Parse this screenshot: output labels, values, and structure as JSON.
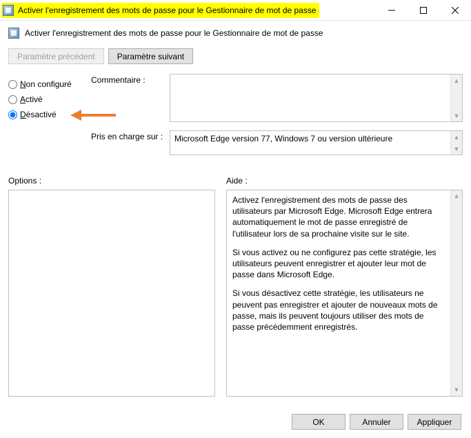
{
  "titlebar": {
    "text": "Activer l'enregistrement des mots de passe pour le Gestionnaire de mot de passe"
  },
  "header": {
    "policy_title": "Activer l'enregistrement des mots de passe pour le Gestionnaire de mot de passe"
  },
  "nav": {
    "prev": "Paramètre précédent",
    "next": "Paramètre suivant"
  },
  "state": {
    "not_configured": "Non configuré",
    "enabled": "Activé",
    "disabled": "Désactivé",
    "selected": "disabled"
  },
  "fields": {
    "comment_label": "Commentaire :",
    "comment_value": "",
    "supported_label": "Pris en charge sur :",
    "supported_value": "Microsoft Edge version 77, Windows 7 ou version ultérieure"
  },
  "panes": {
    "options_label": "Options :",
    "help_label": "Aide :",
    "help_paragraphs": [
      "Activez l'enregistrement des mots de passe des utilisateurs par Microsoft Edge. Microsoft Edge entrera automatiquement le mot de passe enregistré de l'utilisateur lors de sa prochaine visite sur le site.",
      "Si vous activez ou ne configurez pas cette stratégie, les utilisateurs peuvent enregistrer et ajouter leur mot de passe dans Microsoft Edge.",
      "Si vous désactivez cette stratégie, les utilisateurs ne peuvent pas enregistrer et ajouter de nouveaux mots de passe, mais ils peuvent toujours utiliser des mots de passe précédemment enregistrés."
    ]
  },
  "footer": {
    "ok": "OK",
    "cancel": "Annuler",
    "apply": "Appliquer"
  }
}
